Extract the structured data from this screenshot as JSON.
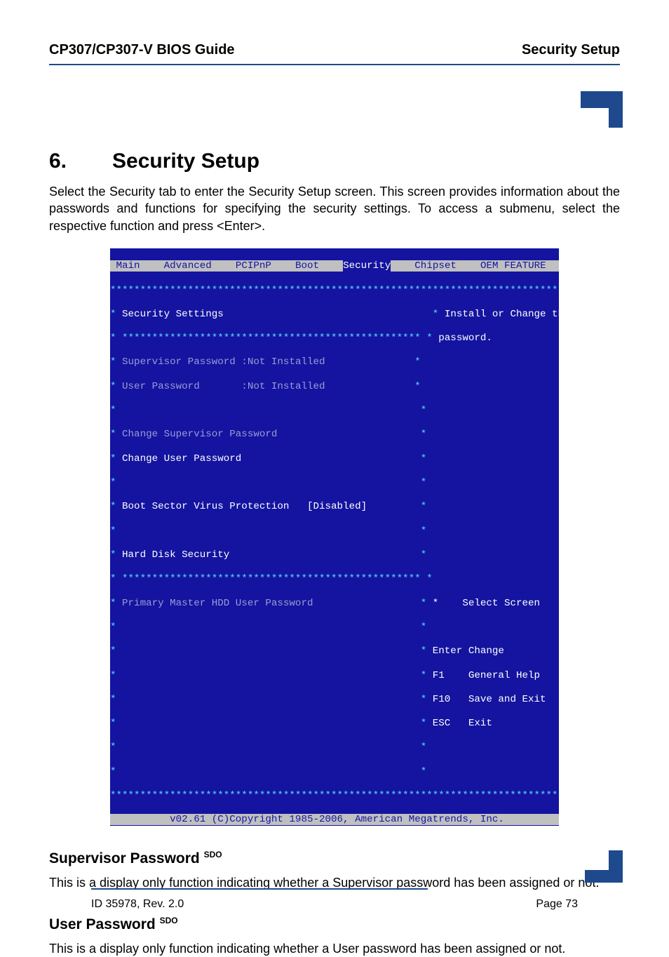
{
  "header": {
    "left": "CP307/CP307-V BIOS Guide",
    "right": "Security Setup"
  },
  "section": {
    "number": "6.",
    "title": "Security Setup"
  },
  "intro": "Select the Security tab to enter the Security Setup screen. This screen provides information about the passwords and functions for specifying the security settings. To access a submenu, select the respective function and press <Enter>.",
  "bios": {
    "tabs": {
      "main": "Main",
      "advanced": "Advanced",
      "pcipnp": "PCIPnP",
      "boot": "Boot",
      "security": "Security",
      "chipset": "Chipset",
      "oem": "OEM FEATURE"
    },
    "left": {
      "security_settings": "Security Settings",
      "supervisor_label": "Supervisor Password :",
      "supervisor_value": "Not Installed",
      "user_label": "User Password       :",
      "user_value": "Not Installed",
      "change_sup": "Change Supervisor Password",
      "change_user": "Change User Password",
      "boot_sector_label": "Boot Sector Virus Protection",
      "boot_sector_value": "[Disabled]",
      "hard_disk_security": "Hard Disk Security",
      "primary_master": "Primary Master HDD User Password"
    },
    "right": {
      "help1": "Install or Change the",
      "help2": "password.",
      "select_screen_arrow": "*",
      "select_screen": "Select Screen",
      "enter_key": "Enter",
      "enter_label": "Change",
      "f1_key": "F1",
      "f1_label": "General Help",
      "f10_key": "F10",
      "f10_label": "Save and Exit",
      "esc_key": "ESC",
      "esc_label": "Exit"
    },
    "footer": "v02.61 (C)Copyright 1985-2006, American Megatrends, Inc."
  },
  "sub1": {
    "title": "Supervisor Password ",
    "sup": "SDO",
    "body": "This is a display only function indicating whether a Supervisor password has been assigned or not."
  },
  "sub2": {
    "title": "User Password ",
    "sup": "SDO",
    "body": "This is a display only function indicating whether a User password has been assigned or not."
  },
  "footer": {
    "left": "ID 35978, Rev. 2.0",
    "right": "Page 73"
  },
  "stars": "****************************************************************************",
  "stars_half": "**************************************************"
}
